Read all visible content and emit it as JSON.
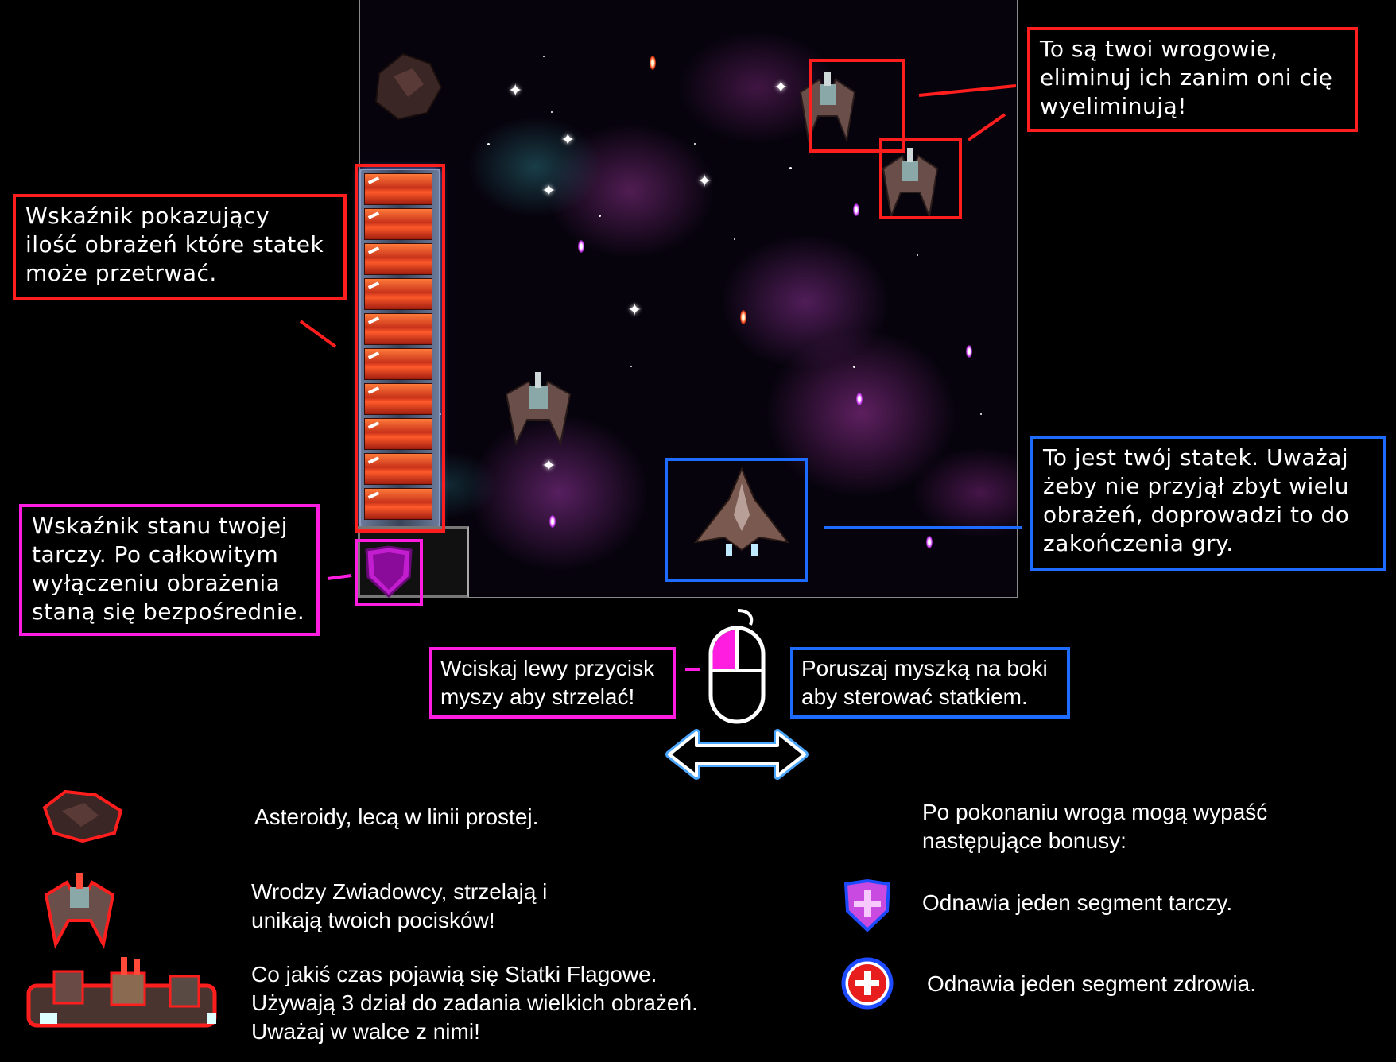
{
  "callouts": {
    "enemies": "To są twoi wrogowie,\neliminuj ich zanim oni cię\nwyeliminują!",
    "health": "Wskaźnik pokazujący\nilość obrażeń które statek\nmoże przetrwać.",
    "ship": "To jest twój statek. Uważaj\nżeby nie przyjął zbyt wielu\nobrażeń, doprowadzi to do\nzakończenia gry.",
    "shield": "Wskaźnik stanu twojej\ntarczy. Po całkowitym\nwyłączeniu obrażenia\nstaną się bezpośrednie."
  },
  "controls": {
    "shoot": "Wciskaj lewy przycisk\nmyszy aby strzelać!",
    "steer": "Poruszaj myszką na boki\naby sterować statkiem."
  },
  "legend": {
    "asteroids": "Asteroidy, lecą w linii prostej.",
    "scouts": "Wrodzy Zwiadowcy, strzelają i\nunikają twoich pocisków!",
    "flagships": "Co jakiś czas pojawią się Statki Flagowe.\nUżywają 3 dział do zadania wielkich obrażeń.\nUważaj w walce z nimi!",
    "bonus_intro": "Po pokonaniu wroga mogą wypaść\nnastępujące bonusy:",
    "bonus_shield": "Odnawia jeden segment tarczy.",
    "bonus_health": "Odnawia jeden segment zdrowia."
  },
  "hud": {
    "health_segments": 10
  },
  "colors": {
    "red": "#ff1e1e",
    "blue": "#1e6bff",
    "pink": "#ff1ee0"
  }
}
